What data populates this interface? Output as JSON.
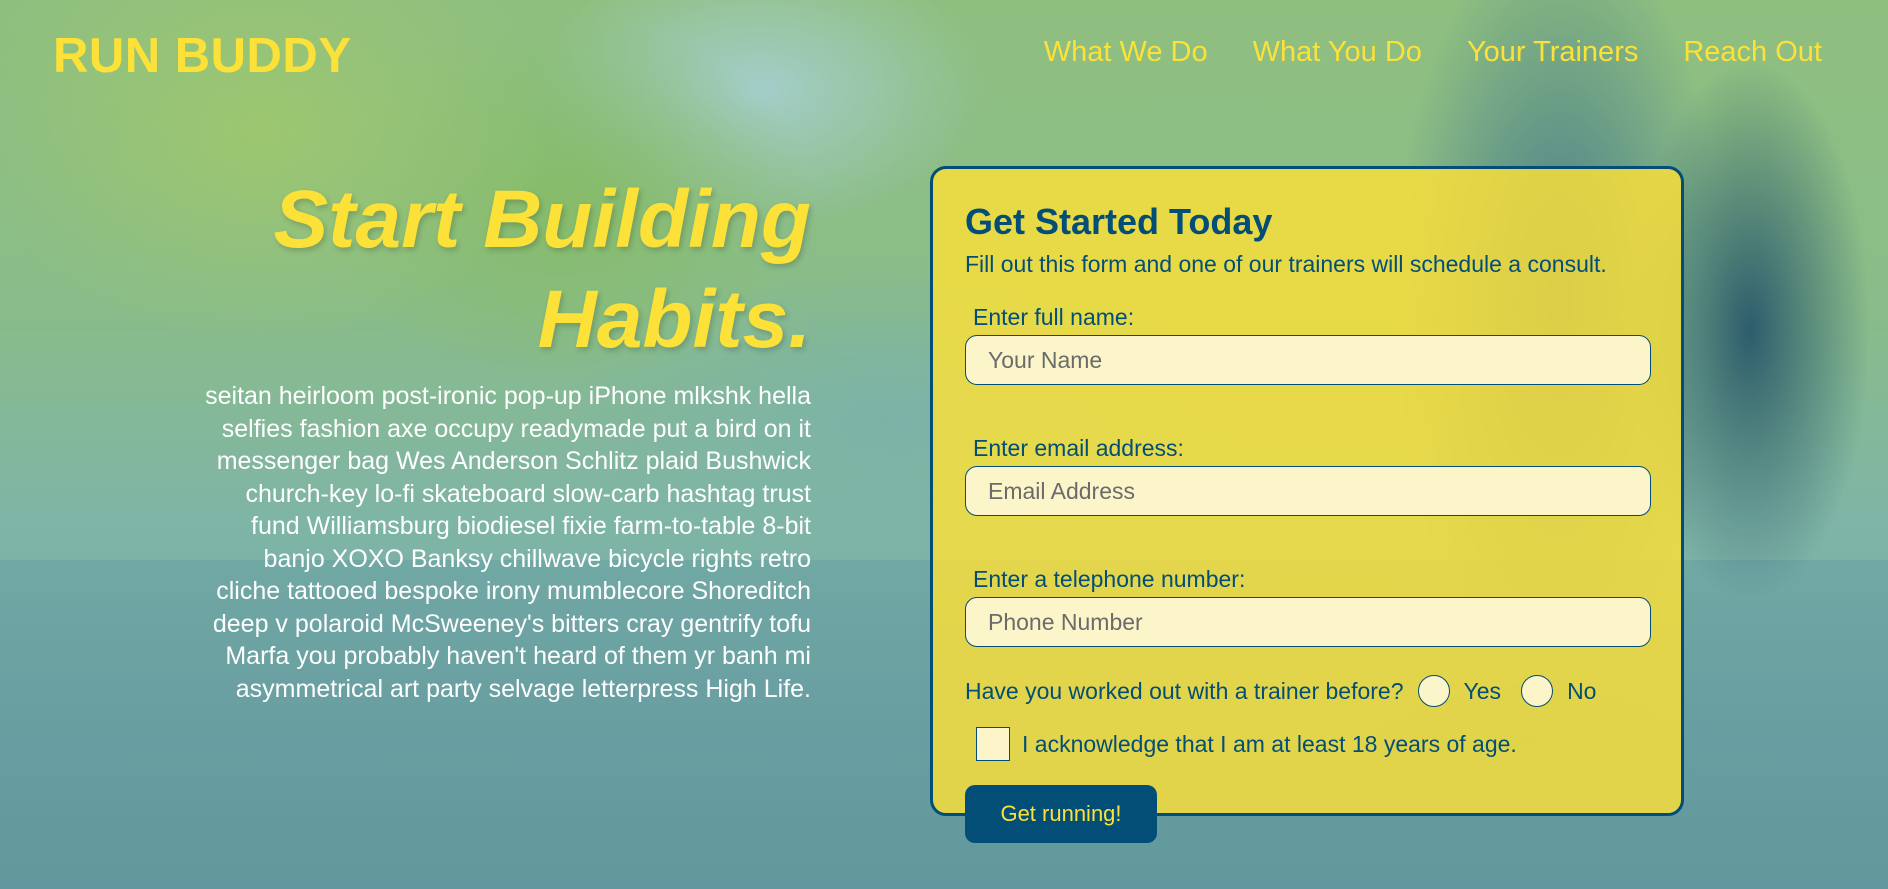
{
  "header": {
    "logo": "RUN BUDDY",
    "nav": [
      "What We Do",
      "What You Do",
      "Your Trainers",
      "Reach Out"
    ]
  },
  "hero": {
    "title_line1": "Start Building",
    "title_line2": "Habits.",
    "copy": "seitan heirloom post-ironic pop-up iPhone mlkshk hella selfies fashion axe occupy readymade put a bird on it messenger bag Wes Anderson Schlitz plaid Bushwick church-key lo-fi skateboard slow-carb hashtag trust fund Williamsburg biodiesel fixie farm-to-table 8-bit banjo XOXO Banksy chillwave bicycle rights retro cliche tattooed bespoke irony mumblecore Shoreditch deep v polaroid McSweeney's bitters cray gentrify tofu Marfa you probably haven't heard of them yr banh mi asymmetrical art party selvage letterpress High Life."
  },
  "form": {
    "title": "Get Started Today",
    "subtitle": "Fill out this form and one of our trainers will schedule a consult.",
    "name_label": "Enter full name:",
    "name_placeholder": "Your Name",
    "email_label": "Enter email address:",
    "email_placeholder": "Email Address",
    "phone_label": "Enter a telephone number:",
    "phone_placeholder": "Phone Number",
    "question": "Have you worked out with a trainer before?",
    "yes_label": "Yes",
    "no_label": "No",
    "ack_label": "I acknowledge that I am at least 18 years of age.",
    "submit_label": "Get running!"
  },
  "colors": {
    "accent": "#fce138",
    "primary": "#024e76",
    "input_bg": "#fbf5c9"
  }
}
